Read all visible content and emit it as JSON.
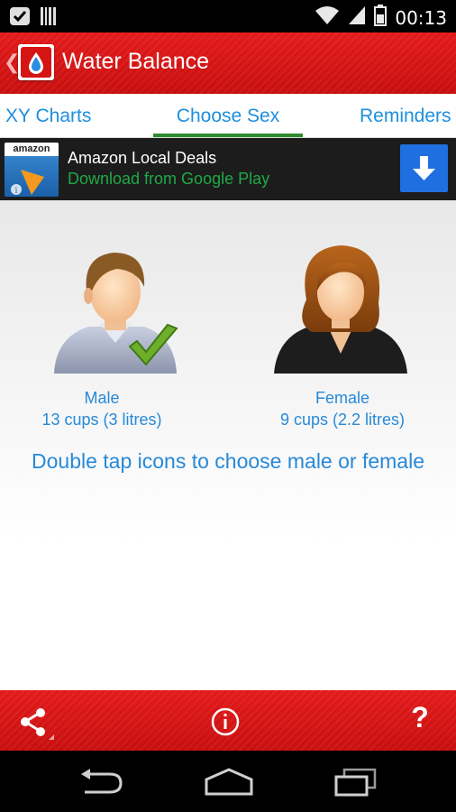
{
  "status_bar": {
    "time": "00:13"
  },
  "app_bar": {
    "title": "Water Balance"
  },
  "tabs": [
    {
      "label": "XY Charts",
      "active": false
    },
    {
      "label": "Choose Sex",
      "active": true
    },
    {
      "label": "Reminders",
      "active": false
    }
  ],
  "ad": {
    "logo_text": "amazon",
    "title": "Amazon Local Deals",
    "subtitle": "Download from Google Play"
  },
  "options": {
    "male": {
      "label": "Male",
      "amount": "13 cups (3 litres)",
      "selected": true
    },
    "female": {
      "label": "Female",
      "amount": "9 cups (2.2 litres)",
      "selected": false
    }
  },
  "instruction": "Double tap icons to choose male or female",
  "toolbar": {
    "help_label": "?"
  },
  "colors": {
    "accent_red": "#d51414",
    "link_blue": "#2789d8",
    "tab_indicator": "#2d8c2d",
    "ad_green": "#1faa46",
    "download_blue": "#1f6fe0"
  },
  "icons": {
    "status_left": [
      "notification-check-icon",
      "barcode-icon"
    ],
    "status_right": [
      "wifi-icon",
      "signal-icon",
      "battery-icon"
    ],
    "toolbar": [
      "share-icon",
      "info-icon",
      "help-icon"
    ],
    "navbar": [
      "back-icon",
      "home-icon",
      "recent-apps-icon"
    ]
  }
}
